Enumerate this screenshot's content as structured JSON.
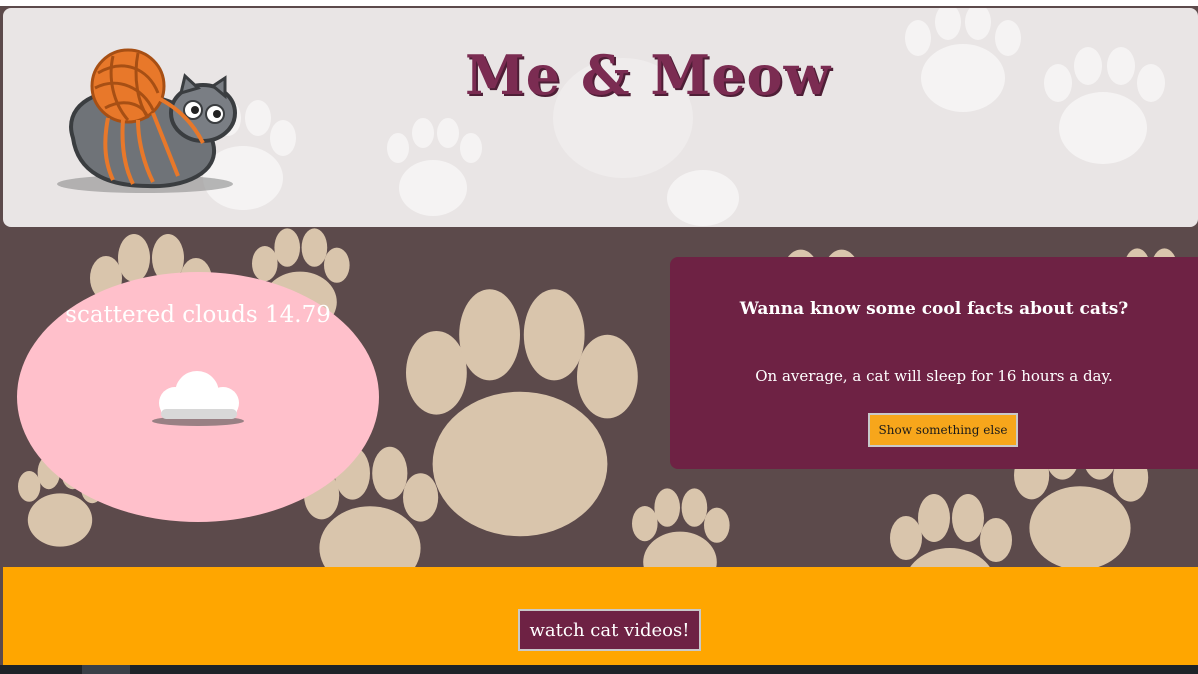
{
  "header": {
    "title": "Me & Meow",
    "logo_icon": "cat-with-yarn-ball-icon"
  },
  "weather": {
    "description": "scattered clouds 14.79",
    "icon": "cloud-icon"
  },
  "facts": {
    "heading": "Wanna know some cool facts about cats?",
    "fact": "On average, a cat will sleep for 16 hours a day.",
    "button_label": "Show something else"
  },
  "footer": {
    "button_label": "watch cat videos!"
  },
  "colors": {
    "brand_plum": "#6e2244",
    "accent_orange": "#ffa600",
    "weather_pink": "#ffc0cb",
    "title_color": "#7b2c52"
  }
}
